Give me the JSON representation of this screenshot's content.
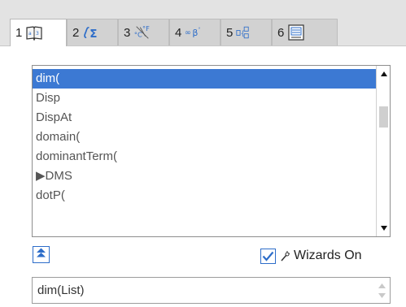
{
  "tabs": [
    {
      "number": "1",
      "icon": "catalog-book-icon",
      "active": true
    },
    {
      "number": "2",
      "icon": "integral-sum-icon",
      "active": false
    },
    {
      "number": "3",
      "icon": "units-icon",
      "active": false
    },
    {
      "number": "4",
      "icon": "infinity-beta-symbols-icon",
      "active": false
    },
    {
      "number": "5",
      "icon": "templates-icon",
      "active": false
    },
    {
      "number": "6",
      "icon": "library-icon",
      "active": false
    }
  ],
  "catalog": {
    "items": [
      "dim(",
      "Disp",
      "DispAt",
      "domain(",
      "dominantTerm(",
      "▶DMS",
      "dotP("
    ],
    "selected_index": 0
  },
  "wizards": {
    "label": "Wizards On",
    "checked": true
  },
  "syntax_help": {
    "text": "dim(List)"
  },
  "colors": {
    "accent": "#3c79d3",
    "tab_bar": "#e3e3e3",
    "border": "#8e8e8e"
  }
}
